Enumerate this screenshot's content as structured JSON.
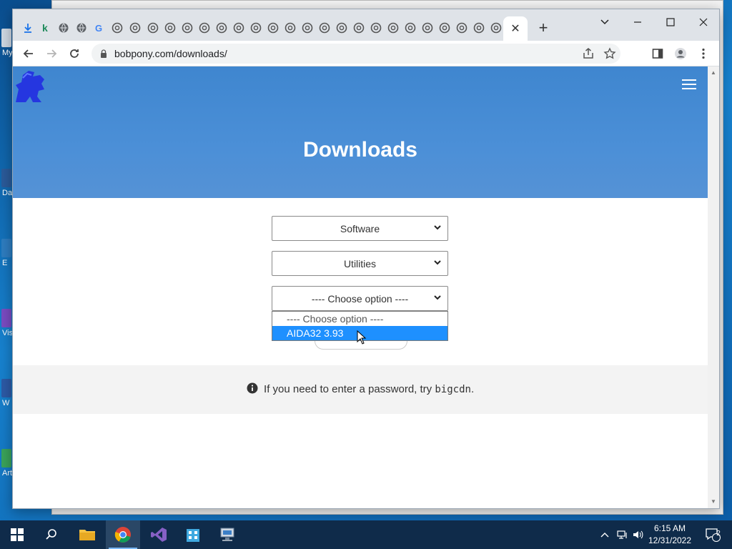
{
  "browser": {
    "url": "bobpony.com/downloads/",
    "tab_count_visible": 29
  },
  "page": {
    "title": "Downloads",
    "selects": {
      "category": "Software",
      "subcategory": "Utilities",
      "option": "---- Choose option ----"
    },
    "dropdown_options": [
      "---- Choose option ----",
      "AIDA32 3.93"
    ],
    "selected_option_index": 1,
    "info_prefix": "If you need to enter a password, try",
    "info_code": "bigcdn",
    "info_suffix": "."
  },
  "desktop": {
    "icon_labels": [
      "My",
      "Da",
      "E",
      "Vis",
      "W",
      "Art"
    ]
  },
  "taskbar": {
    "time": "6:15 AM",
    "date": "12/31/2022",
    "notification_count": "2"
  },
  "colors": {
    "hero_blue": "#4a8fd6",
    "selected_option": "#1e90ff",
    "taskbar": "#0f2b4a"
  }
}
